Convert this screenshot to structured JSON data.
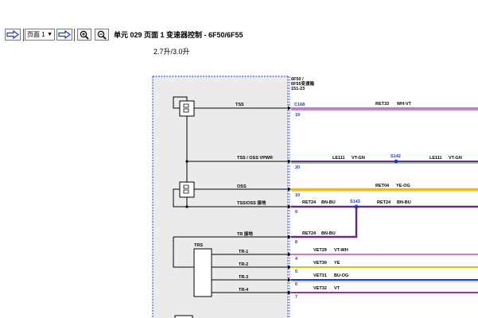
{
  "toolbar": {
    "back_icon": "arrow-right-icon",
    "page_select": "页面 1",
    "next_icon": "arrow-right-icon",
    "zoom_in_icon": "zoom-in-icon",
    "zoom_out_icon": "zoom-out-icon",
    "title": "单元 029 页面 1 变速器控制 - 6F50/6F55"
  },
  "subtitle": "2.7升/3.0升",
  "diagram": {
    "module_label": [
      "6F50 /",
      "6F55变速箱",
      "151-23"
    ],
    "inputs": [
      {
        "label": "TSS",
        "pin": "19",
        "connector": "C168"
      },
      {
        "label": "TSS / OSS VPWR",
        "pin": "20"
      },
      {
        "label": "OSS",
        "pin": "10"
      },
      {
        "label": "TSS/OSS 接地",
        "pin": "9"
      },
      {
        "label": "TR 接地",
        "pin": "8"
      },
      {
        "label": "TR-1",
        "pin": "4"
      },
      {
        "label": "TR-2",
        "pin": "5"
      },
      {
        "label": "TR-3",
        "pin": "6"
      },
      {
        "label": "TR-4",
        "pin": "7"
      }
    ],
    "trs_label": "TRS",
    "wires": [
      {
        "circuit": "RET33",
        "color": "WH-VT"
      },
      {
        "circuit": "LE111",
        "color": "VT-GN"
      },
      {
        "circuit": "LE111",
        "color": "VT-GN"
      },
      {
        "circuit": "RET04",
        "color": "YE-OG"
      },
      {
        "circuit": "RET24",
        "color": "BN-BU"
      },
      {
        "circuit": "RET24",
        "color": "BN-BU"
      },
      {
        "circuit": "RET24",
        "color": "BN-BU"
      },
      {
        "circuit": "VET29",
        "color": "VT-WH"
      },
      {
        "circuit": "VET30",
        "color": "YE"
      },
      {
        "circuit": "VET31",
        "color": "BU-OG"
      },
      {
        "circuit": "VET32",
        "color": "VT"
      }
    ],
    "splices": [
      "S142",
      "S143"
    ],
    "colors": {
      "wire_pink": "#d070c8",
      "wire_violet": "#6a2a8a",
      "wire_yellow": "#e8c000",
      "wire_blue": "#1a3ad0",
      "module_fill": "#ebebeb"
    }
  }
}
